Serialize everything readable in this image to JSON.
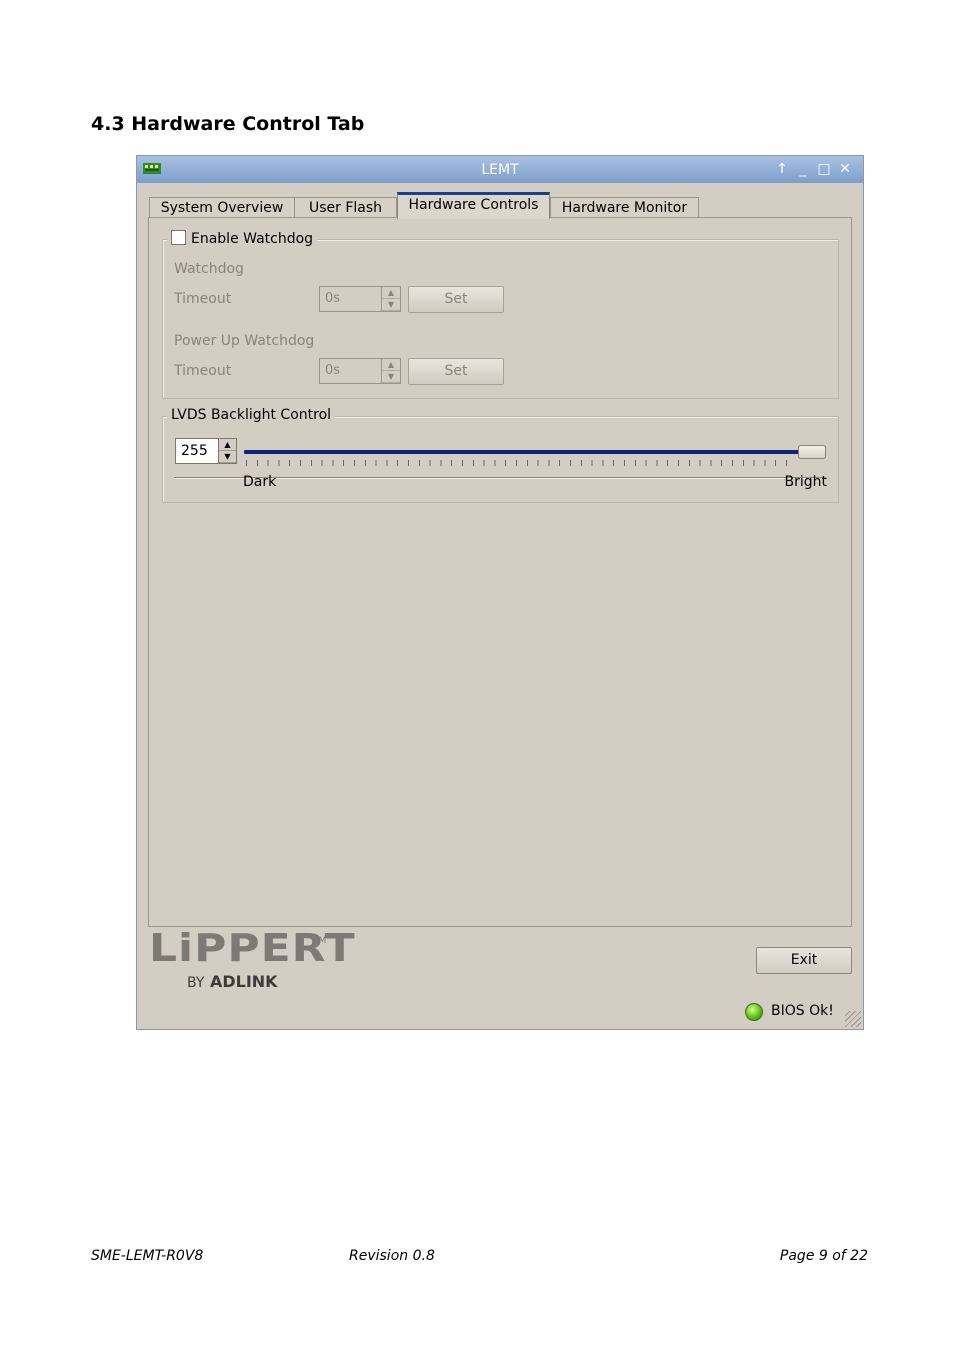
{
  "heading": "4.3  Hardware Control Tab",
  "window": {
    "title": "LEMT",
    "controls": {
      "up": "↑",
      "minimize": "_",
      "maximize": "□",
      "close": "✕"
    }
  },
  "tabs": [
    {
      "label": "System Overview"
    },
    {
      "label": "User Flash"
    },
    {
      "label": "Hardware Controls"
    },
    {
      "label": "Hardware Monitor"
    }
  ],
  "watchdog": {
    "enable_label": "Enable Watchdog",
    "enabled": false,
    "watchdog_label": "Watchdog",
    "timeout_label": "Timeout",
    "timeout_value": "0s",
    "set_label": "Set",
    "powerup_label": "Power Up Watchdog",
    "powerup_timeout_label": "Timeout",
    "powerup_timeout_value": "0s",
    "powerup_set_label": "Set"
  },
  "backlight": {
    "group_label": "LVDS Backlight Control",
    "value": "255",
    "level_fraction": 1.0,
    "min_label": "Dark",
    "max_label": "Bright"
  },
  "logo": {
    "main": "LiPPERT",
    "tm": "TM",
    "by": "BY",
    "brand": "ADLINK"
  },
  "exit_label": "Exit",
  "status_text": "BIOS Ok!",
  "colors": {
    "title_bar": "#7d9ecb",
    "active_tab_accent": "#1b3f8c",
    "slider_fill": "#12237a",
    "status_led": "#5fbf12"
  },
  "footer": {
    "left": "SME-LEMT-R0V8",
    "center": "Revision 0.8",
    "right": "Page 9 of 22"
  }
}
